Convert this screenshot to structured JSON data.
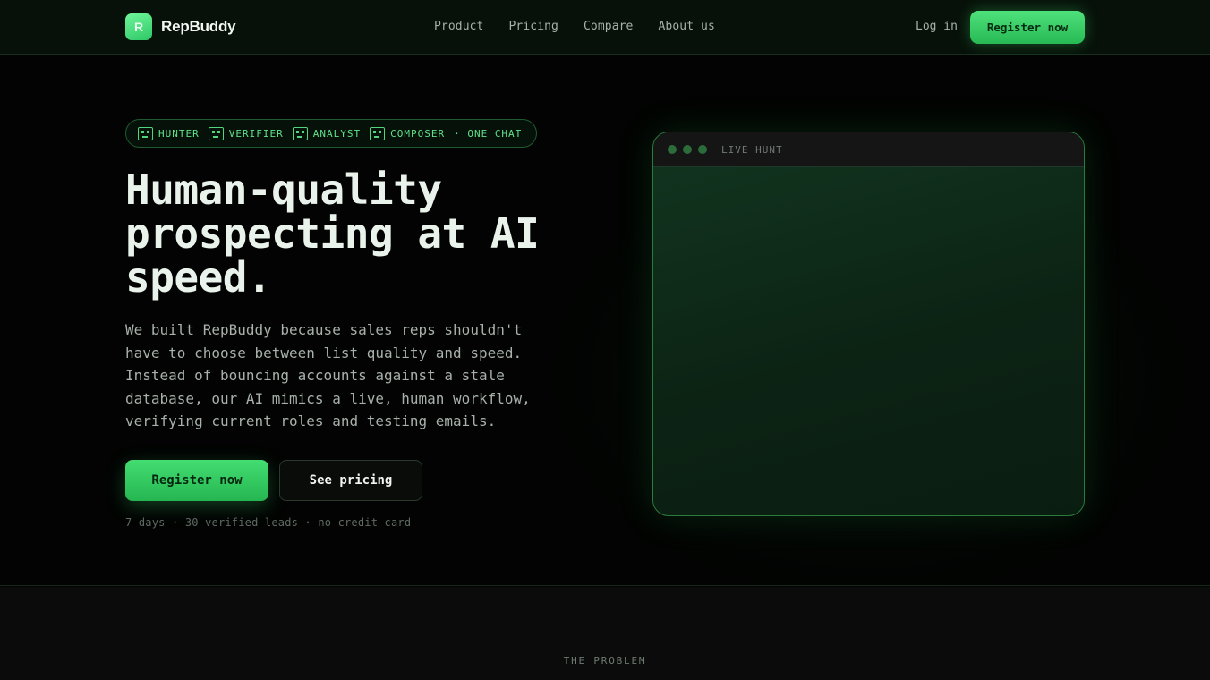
{
  "header": {
    "logo_letter": "R",
    "brand": "RepBuddy",
    "nav": [
      "Product",
      "Pricing",
      "Compare",
      "About us"
    ],
    "login": "Log in",
    "register": "Register now"
  },
  "hero": {
    "agents": [
      {
        "icon": "robot-hunter-icon",
        "label": "HUNTER"
      },
      {
        "icon": "robot-verifier-icon",
        "label": "VERIFIER"
      },
      {
        "icon": "robot-analyst-icon",
        "label": "ANALYST"
      },
      {
        "icon": "robot-composer-icon",
        "label": "COMPOSER"
      }
    ],
    "agents_tail": "· ONE CHAT",
    "headline": "Human-quality prospecting at AI speed.",
    "subtext": "We built RepBuddy because sales reps shouldn't have to choose between list quality and speed. Instead of bouncing accounts against a stale database, our AI mimics a live, human workflow, verifying current roles and testing emails.",
    "cta_primary": "Register now",
    "cta_secondary": "See pricing",
    "fine_print": "7 days · 30 verified leads · no credit card"
  },
  "preview": {
    "title": "LIVE HUNT"
  },
  "next_section": {
    "eyebrow": "THE PROBLEM"
  },
  "colors": {
    "accent": "#3ddc6f",
    "background": "#030403",
    "panel": "#0c2314"
  }
}
